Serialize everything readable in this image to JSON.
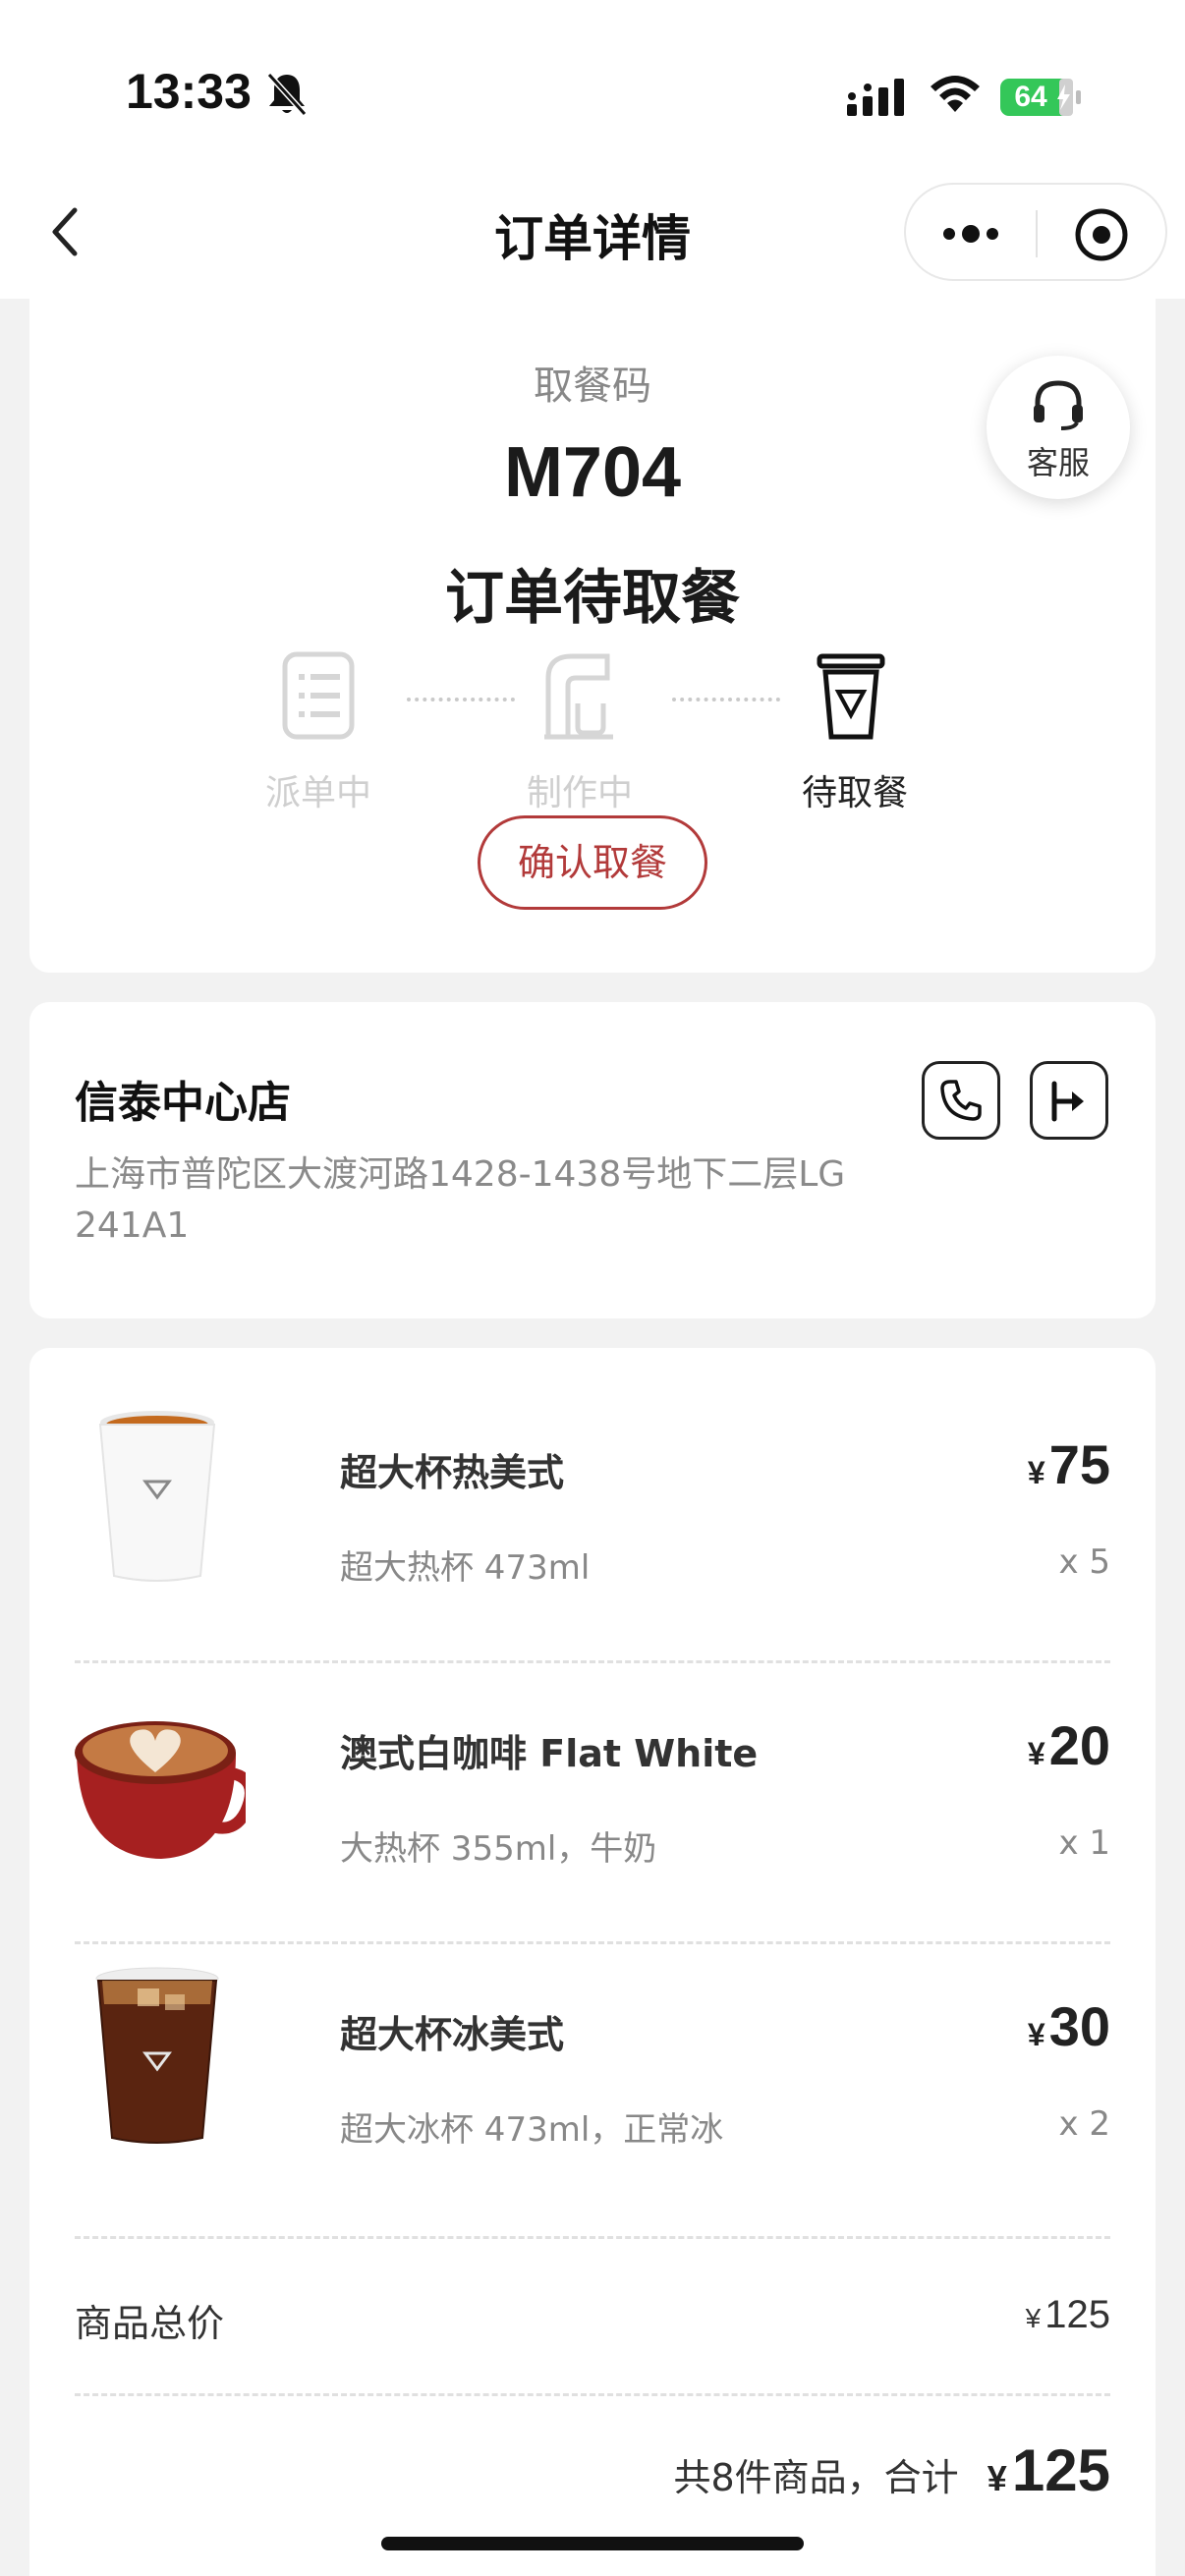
{
  "status_bar": {
    "time": "13:33",
    "battery": "64",
    "icons": [
      "bell-slash-icon",
      "signal-icon",
      "wifi-icon",
      "battery-charging-icon"
    ]
  },
  "nav": {
    "title": "订单详情",
    "icons": [
      "chevron-left-icon",
      "more-dots-icon",
      "target-icon"
    ]
  },
  "order": {
    "pickup_label": "取餐码",
    "pickup_code": "M704",
    "status_title": "订单待取餐",
    "service_label": "客服",
    "steps": [
      {
        "label": "派单中",
        "active": false,
        "icon": "order-list-icon"
      },
      {
        "label": "制作中",
        "active": false,
        "icon": "coffee-machine-icon"
      },
      {
        "label": "待取餐",
        "active": true,
        "icon": "cup-icon"
      }
    ],
    "confirm_label": "确认取餐"
  },
  "store": {
    "name": "信泰中心店",
    "address": "上海市普陀区大渡河路1428-1438号地下二层LG 241A1",
    "icons": [
      "phone-icon",
      "navigate-icon"
    ]
  },
  "items": [
    {
      "name": "超大杯热美式",
      "spec": "超大热杯 473ml",
      "currency": "¥",
      "price": "75",
      "qty": "x 5",
      "image": "hot-americano-cup"
    },
    {
      "name": "澳式白咖啡 Flat White",
      "spec": "大热杯 355ml，牛奶",
      "currency": "¥",
      "price": "20",
      "qty": "x 1",
      "image": "flat-white-red-mug"
    },
    {
      "name": "超大杯冰美式",
      "spec": "超大冰杯 473ml，正常冰",
      "currency": "¥",
      "price": "30",
      "qty": "x 2",
      "image": "iced-americano-cup"
    }
  ],
  "totals": {
    "subtotal_label": "商品总价",
    "subtotal_currency": "¥",
    "subtotal_value": "125",
    "summary_text": "共8件商品，合计",
    "summary_currency": "¥",
    "summary_value": "125"
  },
  "colors": {
    "accent": "#b23a3a",
    "battery": "#34c759",
    "background": "#f2f2f2"
  }
}
